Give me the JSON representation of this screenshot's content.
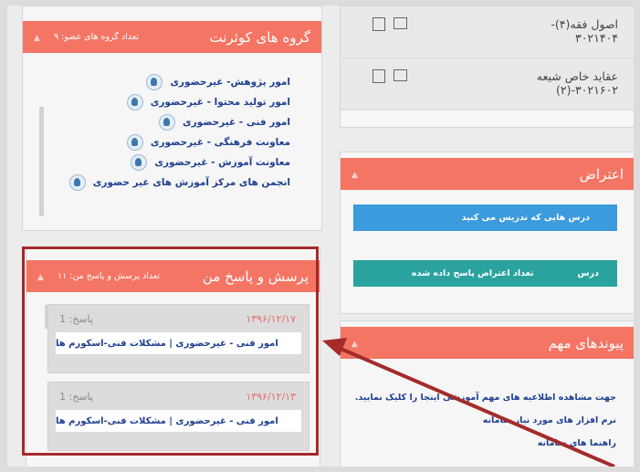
{
  "groups_panel": {
    "title": "گروه های کوثرنت",
    "count": "تعداد گروه های عضو: ۹",
    "items": [
      {
        "label": "امور پژوهش- غیرحضوری"
      },
      {
        "label": "امور تولید محتوا - غیرحضوری"
      },
      {
        "label": "امور فنی - غیرحضوری"
      },
      {
        "label": "معاونت فرهنگی - غیرحضوری"
      },
      {
        "label": "معاونت آموزش - غیرحضوری"
      },
      {
        "label": "انجمن های مرکز آموزش های غیر حضوری"
      }
    ]
  },
  "qa_panel": {
    "title": "پرسش و پاسخ من",
    "count": "تعداد پرسش و پاسخ من: ۱۱",
    "items": [
      {
        "answers": "پاسخ: 1",
        "date": "۱۳۹۶/۱۲/۱۷",
        "link": "امور فنی - غیرحضوری | مشکلات فنی-اسکورم ها"
      },
      {
        "answers": "پاسخ: 1",
        "date": "۱۳۹۶/۱۲/۱۳",
        "link": "امور فنی - غیرحضوری | مشکلات فنی-اسکورم ها"
      }
    ]
  },
  "courses": [
    {
      "name": "اصول فقه(۴)-\n۳۰۲۱۴۰۴"
    },
    {
      "name": "عقاید خاص شیعه\n۳۰۲۱۶۰۲-(۲)"
    }
  ],
  "objection_panel": {
    "title": "اعتراض",
    "bar1": "درس هایی که تدریس می کنید",
    "bar2_left": "تعداد اعتراض پاسخ داده شده",
    "bar2_right": "درس"
  },
  "links_panel": {
    "title": "پیوندهای مهم",
    "lines": [
      "جهت مشاهده اطلاعیه های مهم آموزشی اینجا را کلیک نمایید.",
      "نرم افزار های مورد نیاز سامانه",
      "راهنما های سامانه"
    ]
  },
  "colors": {
    "accent": "#f47564",
    "blue_bar": "#3c9bdc",
    "teal_bar": "#2aa39f",
    "highlight": "#a52a2a"
  }
}
